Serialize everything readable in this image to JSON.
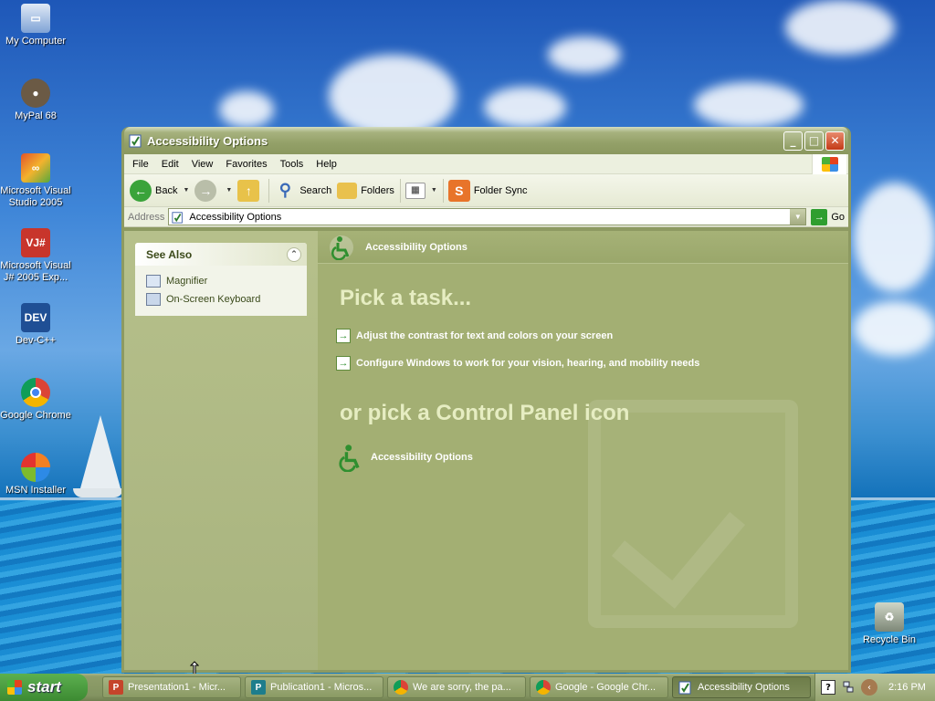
{
  "desktop": {
    "icons": [
      {
        "label": "My Computer",
        "icon": "my-computer-icon"
      },
      {
        "label": "MyPal 68",
        "icon": "mypal-icon"
      },
      {
        "label": "Microsoft Visual Studio 2005",
        "icon": "visual-studio-icon"
      },
      {
        "label": "Microsoft Visual J# 2005 Exp...",
        "icon": "visual-jsharp-icon"
      },
      {
        "label": "Dev-C++",
        "icon": "devcpp-icon"
      },
      {
        "label": "Google Chrome",
        "icon": "chrome-icon"
      },
      {
        "label": "MSN Installer",
        "icon": "msn-icon"
      },
      {
        "label": "Recycle Bin",
        "icon": "recycle-bin-icon"
      }
    ]
  },
  "window": {
    "title": "Accessibility Options",
    "menu": [
      "File",
      "Edit",
      "View",
      "Favorites",
      "Tools",
      "Help"
    ],
    "toolbar": {
      "back": "Back",
      "search": "Search",
      "folders": "Folders",
      "folder_sync": "Folder Sync"
    },
    "address": {
      "label": "Address",
      "value": "Accessibility Options",
      "go": "Go"
    },
    "see_also": {
      "title": "See Also",
      "links": [
        "Magnifier",
        "On-Screen Keyboard"
      ]
    },
    "main": {
      "banner_title": "Accessibility Options",
      "pick_task": "Pick a task...",
      "tasks": [
        "Adjust the contrast for text and colors on your screen",
        "Configure Windows to work for your vision, hearing, and mobility needs"
      ],
      "pick_icon": "or pick a Control Panel icon",
      "icons": [
        "Accessibility Options"
      ]
    }
  },
  "taskbar": {
    "start": "start",
    "buttons": [
      {
        "label": "Presentation1 - Micr...",
        "icon": "powerpoint-icon",
        "active": false
      },
      {
        "label": "Publication1 - Micros...",
        "icon": "publisher-icon",
        "active": false
      },
      {
        "label": "We are sorry, the pa...",
        "icon": "chrome-icon",
        "active": false
      },
      {
        "label": "Google - Google Chr...",
        "icon": "chrome-icon",
        "active": false
      },
      {
        "label": "Accessibility Options",
        "icon": "control-panel-icon",
        "active": true
      }
    ],
    "clock": "2:16 PM"
  },
  "colors": {
    "accent": "#93a068",
    "pane": "#a3af73"
  }
}
